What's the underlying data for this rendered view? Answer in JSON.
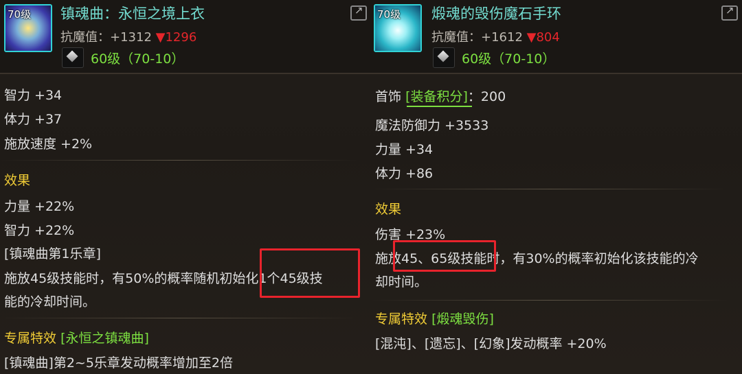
{
  "left": {
    "icon_level": "70级",
    "name": "镇魂曲：永恒之境上衣",
    "stat_label": "抗魔值：",
    "stat_value": "+1312",
    "stat_compare": "▼1296",
    "gem_level": "60级（70-10）",
    "attrs": [
      "智力 +34",
      "体力 +37",
      "施放速度 +2%"
    ],
    "effect_title": "效果",
    "effects": [
      "力量 +22%",
      "智力 +22%",
      "[镇魂曲第1乐章]",
      "施放45级技能时，有50%的概率随机初始化1个45级技",
      "能的冷却时间。"
    ],
    "exclusive_label": "专属特效",
    "exclusive_name": "[永恒之镇魂曲]",
    "exclusive_desc": "[镇魂曲]第2~5乐章发动概率增加至2倍"
  },
  "right": {
    "icon_level": "70级",
    "name": "煅魂的毁伤魔石手环",
    "stat_label": "抗魔值：",
    "stat_value": "+1612",
    "stat_compare": "▼804",
    "gem_level": "60级（70-10）",
    "slot": "首饰",
    "score_label": "[装备积分]",
    "score_value": "：200",
    "attrs": [
      "魔法防御力 +3533",
      "力量 +34",
      "体力 +86"
    ],
    "effect_title": "效果",
    "effects": [
      "伤害 +23%",
      "施放45、65级技能时，有30%的概率初始化该技能的冷",
      "却时间。"
    ],
    "exclusive_label": "专属特效",
    "exclusive_name": "[煅魂毁伤]",
    "exclusive_desc": "[混沌]、[遗忘]、[幻象]发动概率 +20%"
  }
}
